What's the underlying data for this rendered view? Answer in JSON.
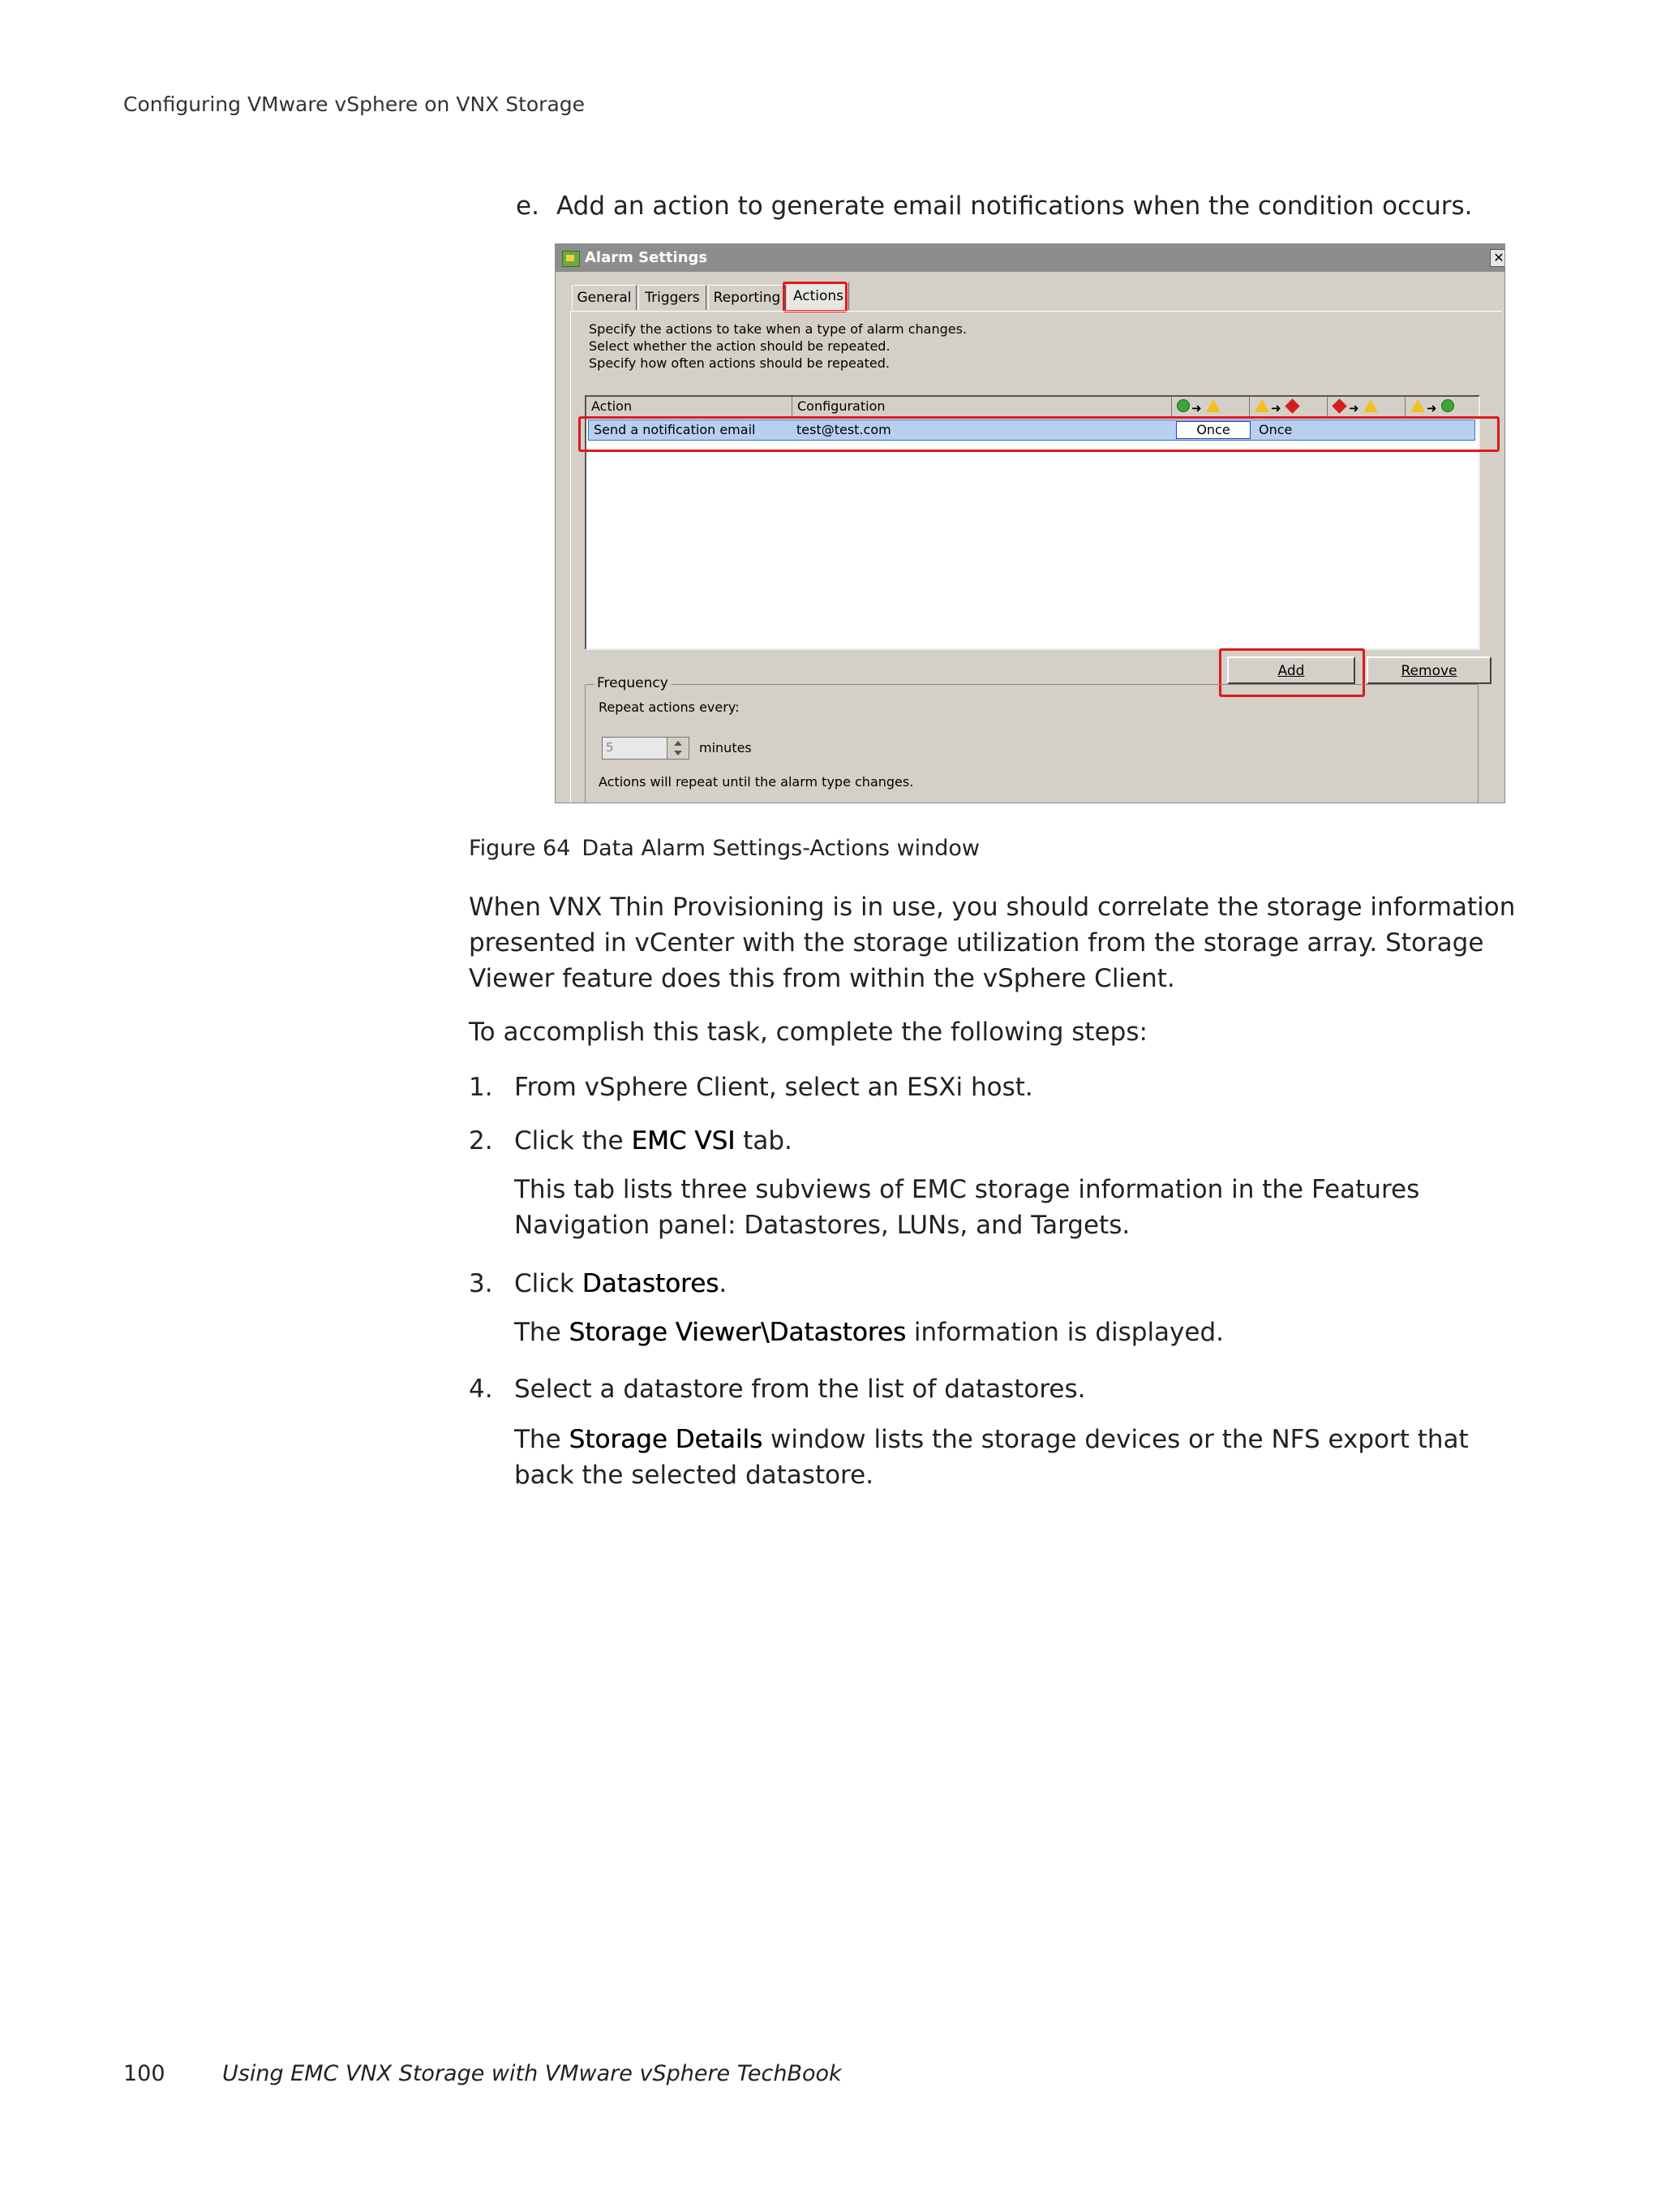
{
  "running_header": "Configuring VMware vSphere on VNX Storage",
  "step_e": {
    "label": "e.",
    "text": "Add an action to generate email notifications when the condition occurs."
  },
  "dialog": {
    "title": "Alarm Settings",
    "close_glyph": "✕",
    "tabs": [
      "General",
      "Triggers",
      "Reporting",
      "Actions"
    ],
    "active_tab": "Actions",
    "instructions": [
      "Specify the actions to take when a type of alarm changes.",
      "Select whether the action should be repeated.",
      "Specify how often actions should be repeated."
    ],
    "columns": {
      "action": "Action",
      "configuration": "Configuration"
    },
    "transition_icons": [
      [
        "ok-icon",
        "warning-icon"
      ],
      [
        "warning-icon",
        "critical-icon"
      ],
      [
        "critical-icon",
        "warning-icon"
      ],
      [
        "warning-icon",
        "ok-icon"
      ]
    ],
    "row": {
      "action": "Send a notification email",
      "configuration": "test@test.com",
      "repeat_1": "Once",
      "repeat_2": "Once"
    },
    "add_button": "Add",
    "remove_button": "Remove",
    "frequency": {
      "legend": "Frequency",
      "repeat_label": "Repeat actions every:",
      "value": "5",
      "unit": "minutes",
      "note": "Actions will repeat until the alarm type changes."
    },
    "highlight_color": "#e0191c"
  },
  "figure": {
    "number": "Figure 64",
    "caption": "Data Alarm Settings-Actions window"
  },
  "paragraphs": {
    "p1": "When VNX Thin Provisioning is in use, you should correlate the storage information presented in vCenter with the storage utilization from the storage array. Storage Viewer feature does this from within the vSphere Client.",
    "p2": "To accomplish this task, complete the following steps:"
  },
  "steps": {
    "s1": {
      "num": "1.",
      "text": "From vSphere Client, select an ESXi host."
    },
    "s2": {
      "num": "2.",
      "pre": "Click the ",
      "bold": "EMC VSI",
      "post": " tab.",
      "detail": "This tab lists three subviews of EMC storage information in the Features Navigation panel: Datastores, LUNs, and Targets."
    },
    "s3": {
      "num": "3.",
      "pre": "Click ",
      "bold": "Datastores",
      "post": ".",
      "detail_pre": "The ",
      "detail_bold": "Storage Viewer\\Datastores",
      "detail_post": " information is displayed."
    },
    "s4": {
      "num": "4.",
      "text": "Select a datastore from the list of datastores.",
      "detail_pre": "The ",
      "detail_bold": "Storage Details",
      "detail_post": " window lists the storage devices or the NFS export that back the selected datastore."
    }
  },
  "footer": {
    "page_number": "100",
    "book_title": "Using EMC VNX Storage with VMware vSphere TechBook"
  }
}
